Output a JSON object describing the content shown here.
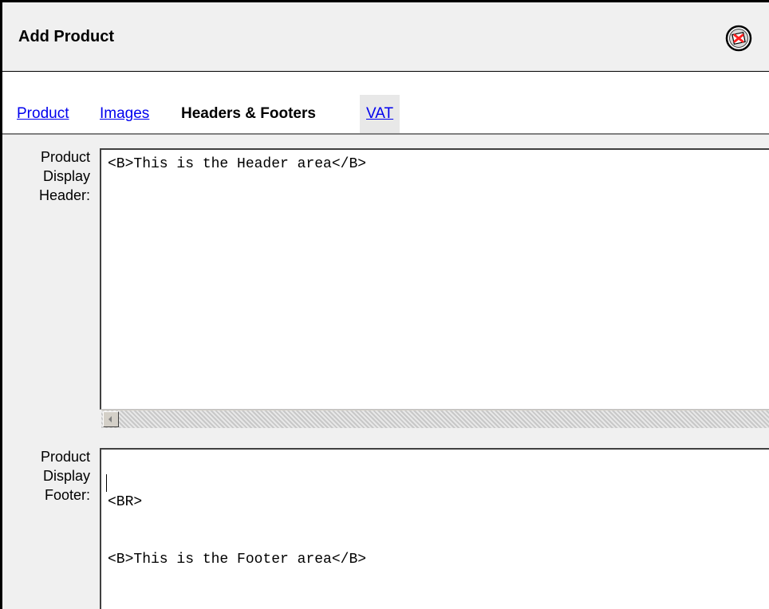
{
  "dialog": {
    "title": "Add Product"
  },
  "tabs": [
    {
      "label": "Product",
      "active": false
    },
    {
      "label": "Images",
      "active": false
    },
    {
      "label": "Headers & Footers",
      "active": true
    },
    {
      "label": "VAT",
      "active": false
    }
  ],
  "fields": {
    "header": {
      "label_lines": [
        "Product",
        "Display",
        "Header:"
      ],
      "value": "<B>This is the Header area</B>"
    },
    "footer": {
      "label_lines": [
        "Product",
        "Display",
        "Footer:"
      ],
      "value_lines": [
        "<BR>",
        "<B>This is the Footer area</B>"
      ]
    }
  },
  "icons": {
    "close": "close-icon"
  }
}
